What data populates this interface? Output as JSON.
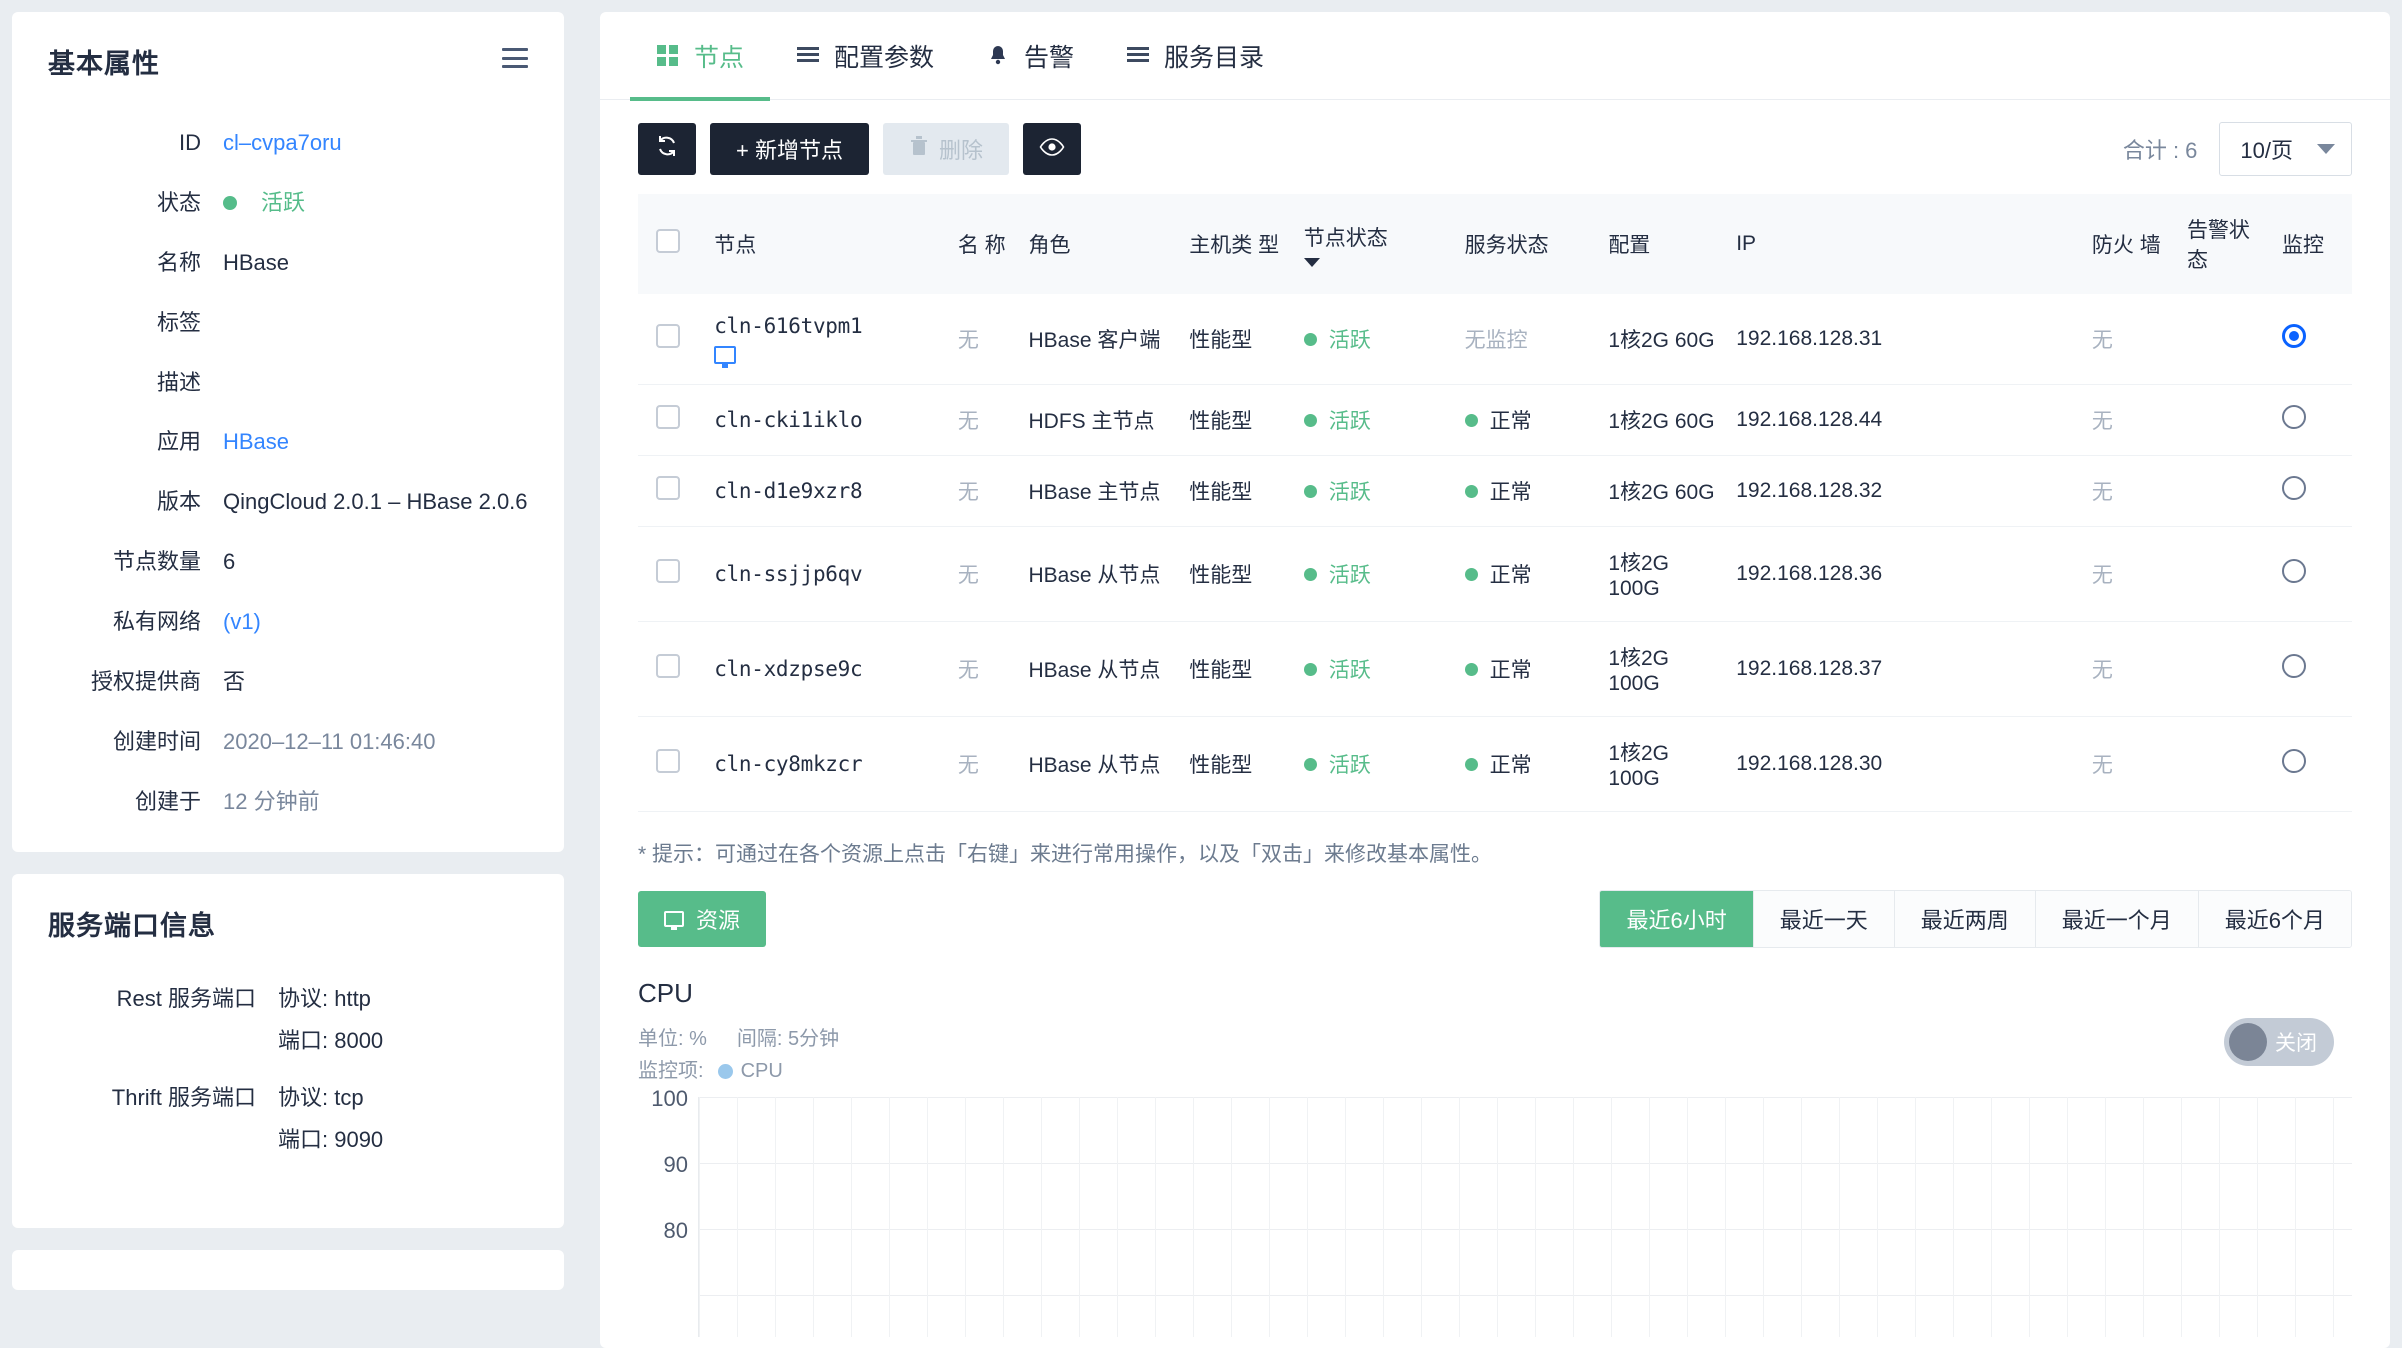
{
  "sidebar": {
    "basic": {
      "title": "基本属性",
      "menu_icon": "hamburger-icon",
      "rows": [
        {
          "label": "ID",
          "value": "cl–cvpa7oru",
          "style": "link"
        },
        {
          "label": "状态",
          "value": "活跃",
          "style": "status"
        },
        {
          "label": "名称",
          "value": "HBase",
          "style": "plain"
        },
        {
          "label": "标签",
          "value": "",
          "style": "plain"
        },
        {
          "label": "描述",
          "value": "",
          "style": "plain"
        },
        {
          "label": "应用",
          "value": "HBase",
          "style": "link"
        },
        {
          "label": "版本",
          "value": "QingCloud 2.0.1 – HBase 2.0.6",
          "style": "plain"
        },
        {
          "label": "节点数量",
          "value": "6",
          "style": "plain"
        },
        {
          "label": "私有网络",
          "value": "(v1)",
          "style": "link"
        },
        {
          "label": "授权提供商",
          "value": "否",
          "style": "plain"
        },
        {
          "label": "创建时间",
          "value": "2020–12–11 01:46:40",
          "style": "muted"
        },
        {
          "label": "创建于",
          "value": "12 分钟前",
          "style": "muted"
        }
      ]
    },
    "ports": {
      "title": "服务端口信息",
      "groups": [
        {
          "label": "Rest 服务端口",
          "protocol": "协议: http",
          "port": "端口: 8000"
        },
        {
          "label": "Thrift 服务端口",
          "protocol": "协议: tcp",
          "port": "端口: 9090"
        }
      ]
    }
  },
  "tabs": [
    {
      "label": "节点",
      "icon": "grid-icon",
      "active": true
    },
    {
      "label": "配置参数",
      "icon": "list-icon",
      "active": false
    },
    {
      "label": "告警",
      "icon": "bell-icon",
      "active": false
    },
    {
      "label": "服务目录",
      "icon": "list-icon",
      "active": false
    }
  ],
  "toolbar": {
    "refresh_label": "",
    "add_label": "+ 新增节点",
    "delete_label": "删除",
    "eye_label": "",
    "total_label": "合计 : 6",
    "pagesize_value": "10/页"
  },
  "table": {
    "columns": [
      "节点",
      "名 称",
      "角色",
      "主机类 型",
      "节点状态",
      "服务状态",
      "配置",
      "IP",
      "防火 墙",
      "告警状 态",
      "监控"
    ],
    "sorted_column": "节点状态",
    "rows": [
      {
        "node": "cln-616tvpm1",
        "has_monitor_icon": true,
        "name": "无",
        "role": "HBase 客户端",
        "host_type": "性能型",
        "node_status": "活跃",
        "service_status": "无监控",
        "service_status_ok": false,
        "config": "1核2G 60G",
        "ip": "192.168.128.31",
        "firewall": "无",
        "alert_status": "",
        "monitor_on": true
      },
      {
        "node": "cln-cki1iklo",
        "has_monitor_icon": false,
        "name": "无",
        "role": "HDFS 主节点",
        "host_type": "性能型",
        "node_status": "活跃",
        "service_status": "正常",
        "service_status_ok": true,
        "config": "1核2G 60G",
        "ip": "192.168.128.44",
        "firewall": "无",
        "alert_status": "",
        "monitor_on": false
      },
      {
        "node": "cln-d1e9xzr8",
        "has_monitor_icon": false,
        "name": "无",
        "role": "HBase 主节点",
        "host_type": "性能型",
        "node_status": "活跃",
        "service_status": "正常",
        "service_status_ok": true,
        "config": "1核2G 60G",
        "ip": "192.168.128.32",
        "firewall": "无",
        "alert_status": "",
        "monitor_on": false
      },
      {
        "node": "cln-ssjjp6qv",
        "has_monitor_icon": false,
        "name": "无",
        "role": "HBase 从节点",
        "host_type": "性能型",
        "node_status": "活跃",
        "service_status": "正常",
        "service_status_ok": true,
        "config": "1核2G 100G",
        "ip": "192.168.128.36",
        "firewall": "无",
        "alert_status": "",
        "monitor_on": false
      },
      {
        "node": "cln-xdzpse9c",
        "has_monitor_icon": false,
        "name": "无",
        "role": "HBase 从节点",
        "host_type": "性能型",
        "node_status": "活跃",
        "service_status": "正常",
        "service_status_ok": true,
        "config": "1核2G 100G",
        "ip": "192.168.128.37",
        "firewall": "无",
        "alert_status": "",
        "monitor_on": false
      },
      {
        "node": "cln-cy8mkzcr",
        "has_monitor_icon": false,
        "name": "无",
        "role": "HBase 从节点",
        "host_type": "性能型",
        "node_status": "活跃",
        "service_status": "正常",
        "service_status_ok": true,
        "config": "1核2G 100G",
        "ip": "192.168.128.30",
        "firewall": "无",
        "alert_status": "",
        "monitor_on": false
      }
    ]
  },
  "hint": "* 提示：可通过在各个资源上点击「右键」来进行常用操作，以及「双击」来修改基本属性。",
  "resource_button": "资源",
  "ranges": [
    {
      "label": "最近6小时",
      "active": true
    },
    {
      "label": "最近一天",
      "active": false
    },
    {
      "label": "最近两周",
      "active": false
    },
    {
      "label": "最近一个月",
      "active": false
    },
    {
      "label": "最近6个月",
      "active": false
    }
  ],
  "monitor_toggle": "关闭",
  "chart_data": {
    "type": "line",
    "title": "CPU",
    "unit_label": "单位: %",
    "interval_label": "间隔: 5分钟",
    "metric_label": "监控项:",
    "series": [
      {
        "name": "CPU",
        "color": "#9ac8ec",
        "values": []
      }
    ],
    "x": [],
    "xlabel": "",
    "ylabel": "%",
    "ylim": [
      0,
      100
    ],
    "yticks": [
      100,
      90,
      80
    ],
    "grid": true,
    "legend": [
      "CPU"
    ],
    "legend_position": "top-left"
  },
  "colors": {
    "accent_green": "#57bc8a",
    "link_blue": "#3385ff",
    "dark": "#1c2433",
    "muted": "#79879c"
  }
}
